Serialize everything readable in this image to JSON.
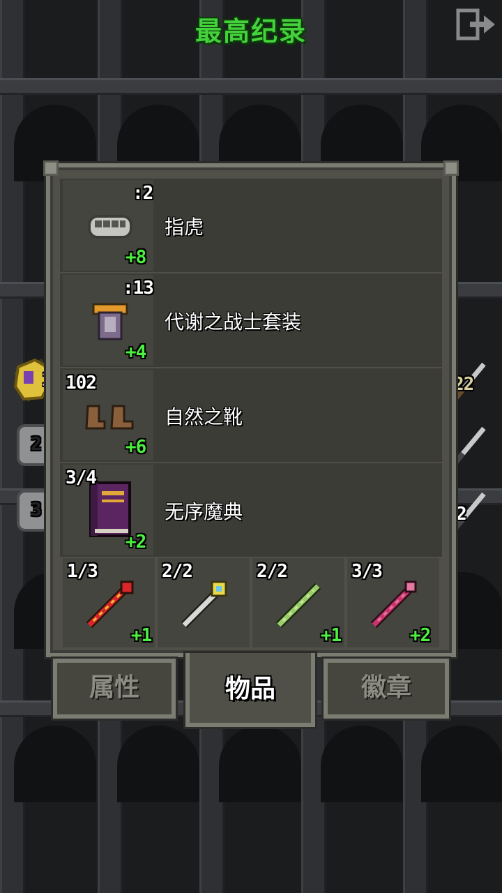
{
  "header": {
    "title": "最高纪录",
    "exit_icon": "exit-icon"
  },
  "items": [
    {
      "icon": "brass-knuckles-icon",
      "count": ":2",
      "name": "指虎",
      "bonus": "+8"
    },
    {
      "icon": "warrior-armor-icon",
      "count": ":13",
      "name": "代谢之战士套装",
      "bonus": "+4"
    },
    {
      "icon": "boots-icon",
      "count": "102",
      "name": "自然之靴",
      "bonus": "+6"
    },
    {
      "icon": "spellbook-icon",
      "count": "3/4",
      "name": "无序魔典",
      "bonus": "+2"
    }
  ],
  "wands": [
    {
      "icon": "fire-wand-icon",
      "count": "1/3",
      "bonus": "+1",
      "colors": [
        "#d8262b",
        "#f3c232"
      ]
    },
    {
      "icon": "gold-staff-icon",
      "count": "2/2",
      "bonus": "",
      "colors": [
        "#d9dad5",
        "#e8d84a"
      ]
    },
    {
      "icon": "green-wand-icon",
      "count": "2/2",
      "bonus": "+1",
      "colors": [
        "#9acd6a",
        "#cfe8a0"
      ]
    },
    {
      "icon": "pink-wand-icon",
      "count": "3/3",
      "bonus": "+2",
      "colors": [
        "#c7356b",
        "#e27aa0"
      ]
    }
  ],
  "tabs": [
    {
      "label": "属性",
      "active": false
    },
    {
      "label": "物品",
      "active": true
    },
    {
      "label": "徽章",
      "active": false
    }
  ],
  "side_left": [
    "1",
    "2",
    "3"
  ],
  "side_right": [
    "22",
    "",
    "2"
  ]
}
